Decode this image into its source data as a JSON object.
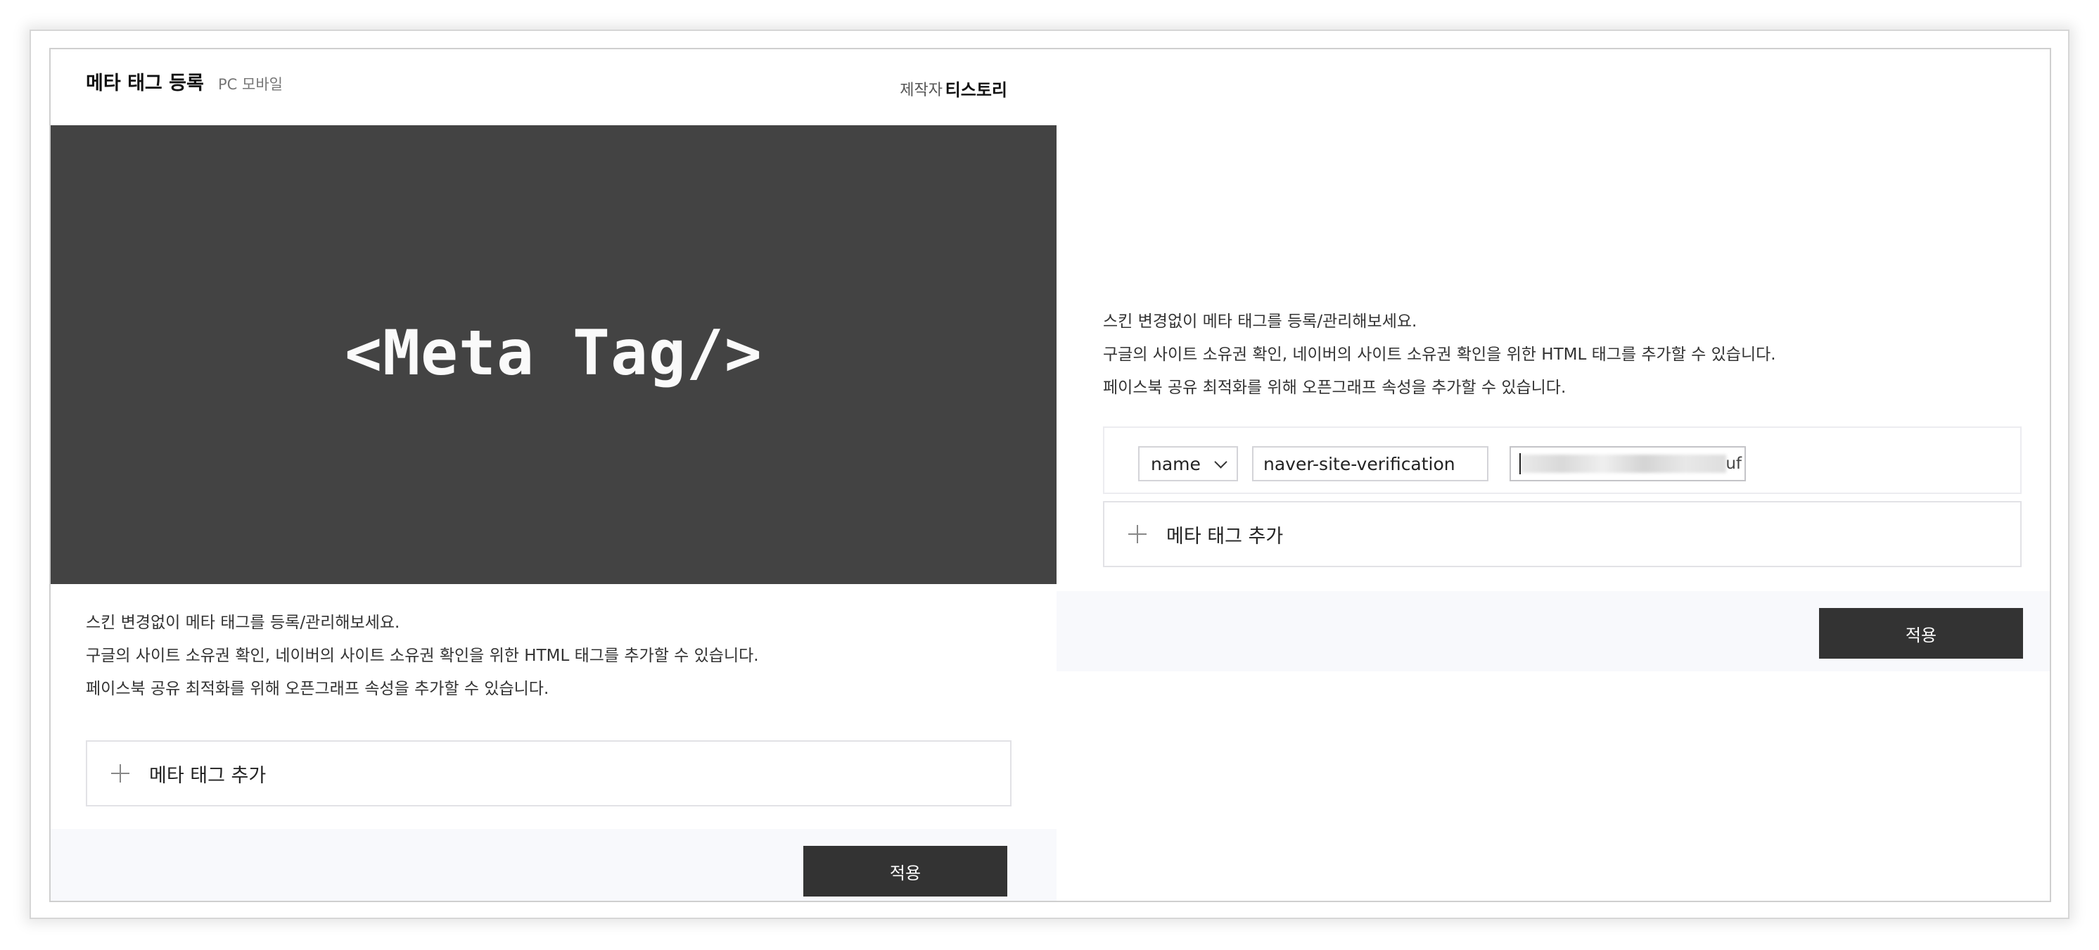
{
  "header": {
    "title": "메타 태그 등록",
    "platform": "PC 모바일",
    "author_label": "제작자",
    "author_name": "티스토리"
  },
  "preview": {
    "text": "<Meta Tag/>"
  },
  "description": {
    "line1": "스킨 변경없이 메타 태그를 등록/관리해보세요.",
    "line2": "구글의 사이트 소유권 확인, 네이버의 사이트 소유권 확인을 위한 HTML 태그를 추가할 수 있습니다.",
    "line3": "페이스북 공유 최적화를 위해 오픈그래프 속성을 추가할 수 있습니다."
  },
  "add_meta_label": "메타 태그 추가",
  "apply_label": "적용",
  "meta_row": {
    "attribute": "name",
    "name_value": "naver-site-verification",
    "content_tail": "uf"
  },
  "colors": {
    "preview_bg": "#434343",
    "button_bg": "#333333",
    "footer_bg": "#f8f9fc"
  }
}
